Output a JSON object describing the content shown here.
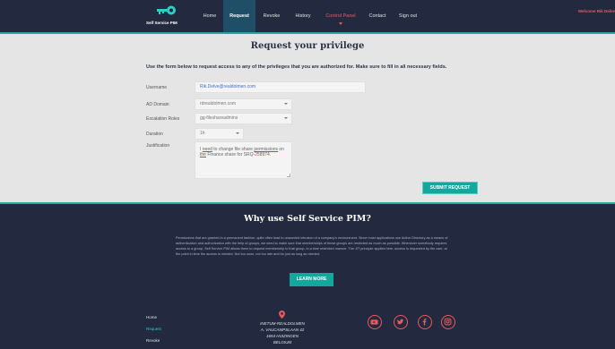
{
  "nav": {
    "brand": "Self Service PIM",
    "items": [
      {
        "label": "Home"
      },
      {
        "label": "Request"
      },
      {
        "label": "Revoke"
      },
      {
        "label": "History"
      },
      {
        "label": "Control Panel"
      },
      {
        "label": "Contact"
      },
      {
        "label": "Sign out"
      }
    ],
    "active": "Request",
    "welcome": "Welcome Rik Delve"
  },
  "form": {
    "title": "Request your privilege",
    "intro": "Use the form below to request access to any of the privileges that you are authorized for. Make sure to fill in all necessary fields.",
    "username_label": "Username",
    "username_value": "Rik.Delve@realdolmen.com",
    "ad_domain_label": "AD Domain",
    "ad_domain_value": "rdrealdolmen.com",
    "escalation_label": "Escalation Roles",
    "escalation_value": "gg-fileshareadmins",
    "duration_label": "Duration",
    "duration_value": "1h",
    "justification_label": "Justification",
    "justification_parts": [
      "I ",
      "need",
      " to change file share ",
      "permissions",
      " on ",
      "the",
      " Finance share for SRQ-258974."
    ],
    "submit_label": "SUBMIT REQUEST"
  },
  "why": {
    "title": "Why use Self Service PIM?",
    "text": "Permissions that are granted in a permanent fashion, quite often lead to unwanted intrusion of a company's environment. Since most applications use Active Directory as a means of authentication and authorization with the help of groups, we need to make sure that memberships of these groups are restricted as much as possible. Whenever somebody requires access to a group, Self Service PIM allows them to request membership to that group, in a time restricted manner. The JIT principle applies here, access is requested by the user, at the point in time the access is needed. Not too soon, not too late and for just as long as needed.",
    "button": "LEARN MORE"
  },
  "footer": {
    "links": [
      "Home",
      "Request",
      "Revoke"
    ],
    "current": "Request",
    "address": [
      "INETUM-REALDOLMEN",
      "A. VAUCAMPSLAAN 42",
      "1654 HUIZINGEN",
      "BELGIUM"
    ],
    "social": [
      "youtube-icon",
      "twitter-icon",
      "facebook-icon",
      "instagram-icon"
    ],
    "accent_color": "#e8595c"
  },
  "colors": {
    "navy": "#232a3f",
    "teal": "#13a89e",
    "active_nav": "#1f4f66",
    "red": "#e8595c"
  }
}
